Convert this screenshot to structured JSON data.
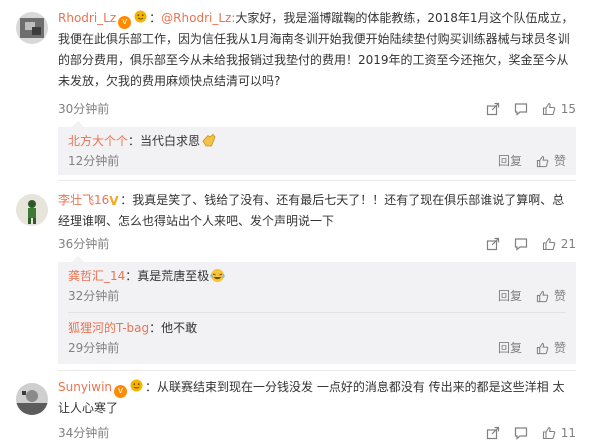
{
  "comments": [
    {
      "user": "Rhodri_Lz",
      "mention": "@Rhodri_Lz:",
      "text": "大家好，我是淄博蹴鞠的体能教练，2018年1月这个队伍成立，我便在此俱乐部工作，因为信任我从1月海南冬训开始我便开始陆续垫付购买训练器械与球员冬训的部分费用，俱乐部至今从未给我报销过我垫付的费用！2019年的工资至今还拖欠，奖金至今从未发放，欠我的费用麻烦快点结清可以吗?",
      "time": "30分钟前",
      "likes": "15",
      "replies": [
        {
          "user": "北方大个个",
          "text": "当代白求恩",
          "time": "12分钟前",
          "reply_label": "回复",
          "like_label": "赞"
        }
      ]
    },
    {
      "user": "李壮飞16",
      "text": "我真是笑了、钱给了没有、还有最后七天了！！还有了现在俱乐部谁说了算啊、总经理谁啊、怎么也得站出个人来吧、发个声明说一下",
      "time": "36分钟前",
      "likes": "21",
      "replies": [
        {
          "user": "龚哲汇_14",
          "text": "真是荒唐至极",
          "time": "32分钟前",
          "reply_label": "回复",
          "like_label": "赞"
        },
        {
          "user": "狐狸河的T-bag",
          "text": "他不敢",
          "time": "29分钟前",
          "reply_label": "回复",
          "like_label": "赞"
        }
      ]
    },
    {
      "user": "Sunyiwin",
      "text": "从联赛结束到现在一分钱没发 一点好的消息都没有 传出来的都是这些洋相 太让人心寒了",
      "time": "34分钟前",
      "likes": "11"
    }
  ],
  "colors": {
    "username": "#eb7350",
    "meta": "#808080",
    "reply_bg": "#f2f2f5",
    "badge": "#ff8a00"
  },
  "icons": [
    "share-icon",
    "comment-icon",
    "like-icon",
    "clap-emoji",
    "laugh-emoji",
    "vip-badge-icon"
  ]
}
